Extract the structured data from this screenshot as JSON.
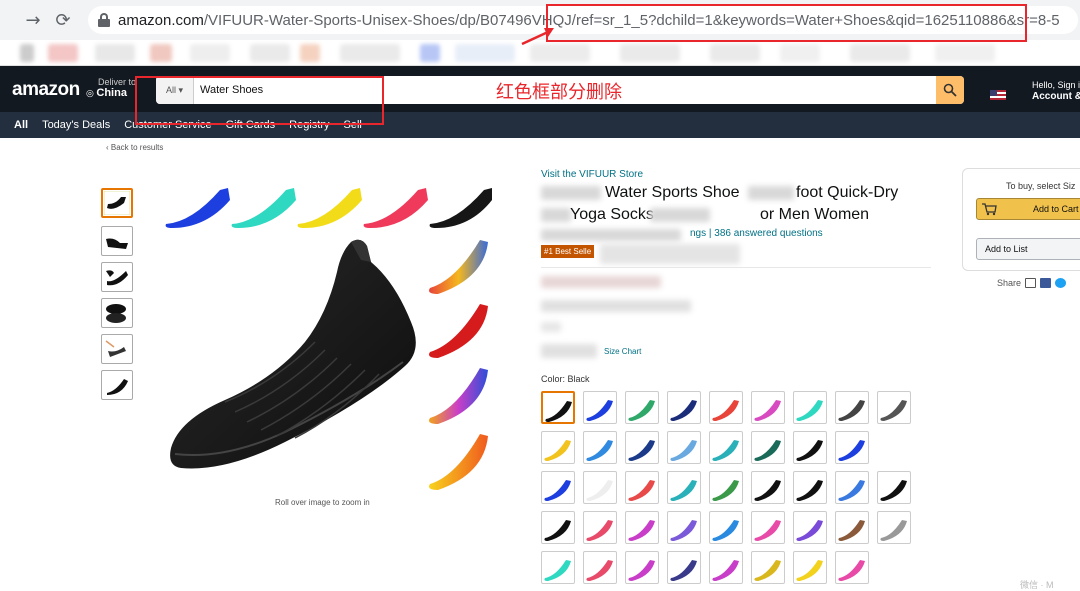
{
  "browser": {
    "back_icon": "arrow-left",
    "reload_icon": "reload",
    "url_host": "amazon.com",
    "url_path": "/VIFUUR-Water-Sports-Unisex-Shoes/dp/B07496VHQJ",
    "url_query": "/ref=sr_1_5?dchild=1&keywords=Water+Shoes&qid=1625110886&sr=8-5"
  },
  "annotation": {
    "text": "红色框部分删除",
    "color": "#e8262b"
  },
  "header": {
    "logo": "amazon",
    "deliver_label": "Deliver to",
    "deliver_location": "China",
    "search_category": "All",
    "search_value": "Water Shoes",
    "signin_line1": "Hello, Sign i",
    "signin_line2": "Account &"
  },
  "subnav": {
    "items": [
      "All",
      "Today's Deals",
      "Customer Service",
      "Gift Cards",
      "Registry",
      "Sell"
    ]
  },
  "product": {
    "back_link": "‹ Back to results",
    "zoom_hint": "Roll over image to zoom in",
    "store_link": "Visit the VIFUUR Store",
    "title_line1": "Water Sports Shoe",
    "title_line1b": "foot Quick-Dry",
    "title_line2a": "Yoga Socks",
    "title_line2b": "or Men Women",
    "ratings_text": "ngs  |  386 answered questions",
    "best_seller": "#1 Best Selle",
    "size_chart": "Size Chart",
    "color_label": "Color: Black"
  },
  "buybox": {
    "to_buy": "To buy, select Siz",
    "add_to_cart": "Add to Cart",
    "add_to_list": "Add to List",
    "share": "Share"
  },
  "colors": {
    "amazon_dark": "#131921",
    "amazon_subnav": "#232f3e",
    "search_button": "#febd69",
    "link": "#007185",
    "badge": "#c45500"
  }
}
